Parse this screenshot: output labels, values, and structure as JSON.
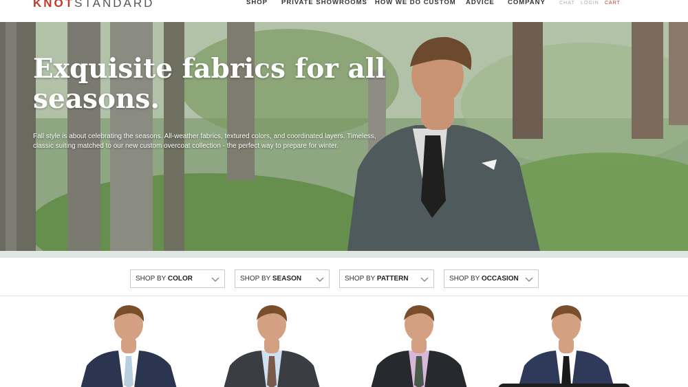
{
  "brand": {
    "logo_part1": "KNOT",
    "logo_part2": "STANDARD",
    "accent_color": "#c0392b"
  },
  "nav": {
    "items": [
      {
        "label": "SHOP"
      },
      {
        "label": "PRIVATE SHOWROOMS"
      },
      {
        "label": "HOW WE DO CUSTOM"
      },
      {
        "label": "ADVICE"
      },
      {
        "label": "COMPANY"
      }
    ],
    "utility": [
      {
        "label": "CHAT"
      },
      {
        "label": "LOGIN"
      },
      {
        "label": "CART"
      }
    ]
  },
  "hero": {
    "title": "Exquisite fabrics for all seasons.",
    "copy": "Fall style is about celebrating the seasons. All-weather fabrics, textured colors, and coordinated layers. Timeless, classic suiting matched to our new custom overcoat collection - the perfect way to prepare for winter."
  },
  "filters": [
    {
      "prefix": "SHOP BY",
      "label": "COLOR"
    },
    {
      "prefix": "SHOP BY",
      "label": "SEASON"
    },
    {
      "prefix": "SHOP BY",
      "label": "PATTERN"
    },
    {
      "prefix": "SHOP BY",
      "label": "OCCASION"
    }
  ],
  "products": [
    {
      "suit_color": "#2b3550",
      "shirt_color": "#ffffff",
      "tie_color": "#b9cfe0",
      "icon": "navy-suit-model"
    },
    {
      "suit_color": "#3a3d42",
      "shirt_color": "#cfe0f2",
      "tie_color": "#7a5a4a",
      "icon": "charcoal-suit-model"
    },
    {
      "suit_color": "#26292e",
      "shirt_color": "#d8b8d8",
      "tie_color": "#4a5a4a",
      "icon": "three-piece-suit-model"
    },
    {
      "suit_color": "#2f3a5a",
      "shirt_color": "#ffffff",
      "tie_color": "#1a1a1a",
      "icon": "blue-suit-model"
    }
  ]
}
